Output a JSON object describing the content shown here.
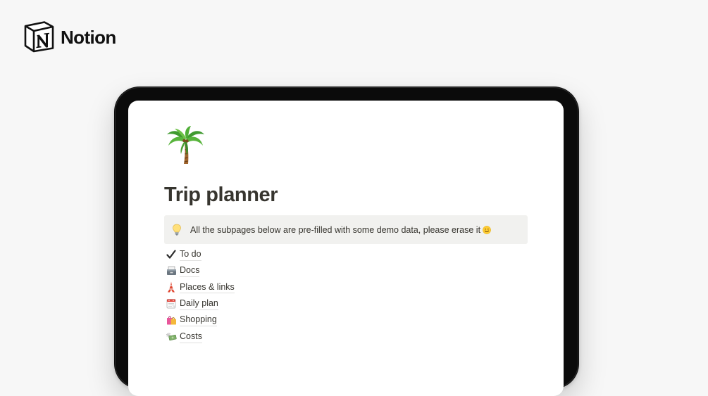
{
  "brand": {
    "name": "Notion"
  },
  "page": {
    "icon": "palm-tree-icon",
    "title": "Trip planner",
    "callout": {
      "icon": "light-bulb-icon",
      "text": "All the subpages below are pre-filled with some demo data, please erase it",
      "trailing_icon": "smiling-face-icon"
    },
    "subpages": [
      {
        "icon": "check-mark-icon",
        "label": "To do"
      },
      {
        "icon": "card-file-box-icon",
        "label": "Docs"
      },
      {
        "icon": "tokyo-tower-icon",
        "label": "Places & links"
      },
      {
        "icon": "calendar-icon",
        "label": "Daily plan"
      },
      {
        "icon": "shopping-bags-icon",
        "label": "Shopping"
      },
      {
        "icon": "money-with-wings-icon",
        "label": "Costs"
      }
    ]
  },
  "colors": {
    "background": "#f7f7f7",
    "device_frame": "#0b0b0b",
    "screen": "#ffffff",
    "text": "#37352f",
    "callout_background": "#f1f1ef"
  }
}
